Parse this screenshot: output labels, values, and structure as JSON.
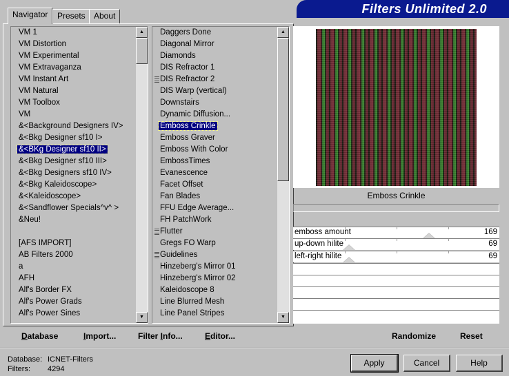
{
  "window": {
    "title": "Filters Unlimited 2.0"
  },
  "tabs": [
    {
      "label": "Navigator",
      "active": true
    },
    {
      "label": "Presets",
      "active": false
    },
    {
      "label": "About",
      "active": false
    }
  ],
  "categories": {
    "items": [
      {
        "label": "VM 1"
      },
      {
        "label": "VM Distortion"
      },
      {
        "label": "VM Experimental"
      },
      {
        "label": "VM Extravaganza"
      },
      {
        "label": "VM Instant Art"
      },
      {
        "label": "VM Natural"
      },
      {
        "label": "VM Toolbox"
      },
      {
        "label": "VM"
      },
      {
        "label": "&<Background Designers IV>"
      },
      {
        "label": "&<Bkg Designer sf10 I>"
      },
      {
        "label": "&<BKg Designer sf10 II>",
        "selected": true
      },
      {
        "label": "&<Bkg Designer sf10 III>"
      },
      {
        "label": "&<Bkg Designers sf10 IV>"
      },
      {
        "label": "&<Bkg Kaleidoscope>"
      },
      {
        "label": "&<Kaleidoscope>"
      },
      {
        "label": "&<Sandflower Specials^v^ >"
      },
      {
        "label": "&Neu!"
      },
      {
        "label": ""
      },
      {
        "label": "[AFS IMPORT]"
      },
      {
        "label": "AB Filters 2000"
      },
      {
        "label": "a"
      },
      {
        "label": "AFH"
      },
      {
        "label": "Alf's Border FX"
      },
      {
        "label": "Alf's Power Grads"
      },
      {
        "label": "Alf's Power Sines"
      }
    ]
  },
  "filters": {
    "items": [
      {
        "label": "Daggers Done"
      },
      {
        "label": "Diagonal Mirror"
      },
      {
        "label": "Diamonds"
      },
      {
        "label": "DIS Refractor 1"
      },
      {
        "label": "DIS Refractor 2",
        "marker": true
      },
      {
        "label": "DIS Warp (vertical)"
      },
      {
        "label": "Downstairs"
      },
      {
        "label": "Dynamic Diffusion..."
      },
      {
        "label": "Emboss Crinkle",
        "selected": true
      },
      {
        "label": "Emboss Graver"
      },
      {
        "label": "Emboss With Color"
      },
      {
        "label": "EmbossTimes"
      },
      {
        "label": "Evanescence"
      },
      {
        "label": "Facet Offset"
      },
      {
        "label": "Fan Blades"
      },
      {
        "label": "FFU Edge Average..."
      },
      {
        "label": "FH PatchWork"
      },
      {
        "label": "Flutter",
        "marker": true
      },
      {
        "label": "Gregs FO Warp"
      },
      {
        "label": "Guidelines",
        "marker": true
      },
      {
        "label": "Hinzeberg's Mirror 01"
      },
      {
        "label": "Hinzeberg's Mirror 02"
      },
      {
        "label": "Kaleidoscope 8"
      },
      {
        "label": "Line Blurred Mesh"
      },
      {
        "label": "Line Panel Stripes"
      }
    ]
  },
  "preview": {
    "filter_name": "Emboss Crinkle"
  },
  "params": [
    {
      "label": "emboss amount",
      "value": "169",
      "fraction": 0.66
    },
    {
      "label": "up-down hilite",
      "value": "69",
      "fraction": 0.27
    },
    {
      "label": "left-right hilite",
      "value": "69",
      "fraction": 0.27
    }
  ],
  "toolbar": {
    "database_u": "D",
    "database_rest": "atabase",
    "import_u": "I",
    "import_rest": "mport...",
    "filterinfo_a": "Filter ",
    "filterinfo_u": "I",
    "filterinfo_rest": "nfo...",
    "editor_u": "E",
    "editor_rest": "ditor...",
    "randomize": "Randomize",
    "reset": "Reset"
  },
  "status": {
    "database_label": "Database:",
    "database_value": "ICNET-Filters",
    "filters_label": "Filters:",
    "filters_value": "4294"
  },
  "buttons": {
    "apply": "Apply",
    "cancel": "Cancel",
    "help": "Help"
  }
}
